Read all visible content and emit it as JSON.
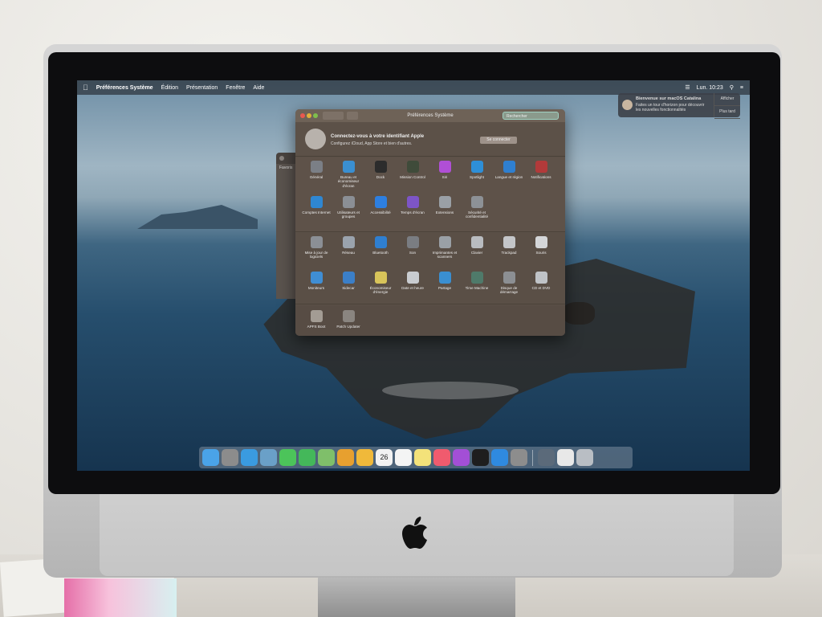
{
  "menubar": {
    "apple_icon": "apple-icon",
    "app_name": "Préférences Système",
    "items": [
      "Édition",
      "Présentation",
      "Fenêtre",
      "Aide"
    ],
    "clock": "Lun. 10:23"
  },
  "notification": {
    "title": "Bienvenue sur macOS Catalina",
    "body": "Faites un tour d'horizon pour découvrir les nouvelles fonctionnalités",
    "show_label": "Afficher",
    "later_label": "Plus tard"
  },
  "finder": {
    "favorites_label": "Favoris"
  },
  "prefs": {
    "title": "Préférences Système",
    "search_placeholder": "Rechercher",
    "account": {
      "title": "Connectez-vous à votre identifiant Apple",
      "subtitle": "Configurez iCloud, App Store et bien d'autres.",
      "button": "Se connecter"
    },
    "section1": [
      {
        "label": "Général",
        "icon": "general-icon",
        "color": "#7b7f86"
      },
      {
        "label": "Bureau et économiseur d'écran",
        "icon": "desktop-icon",
        "color": "#3a8fd1"
      },
      {
        "label": "Dock",
        "icon": "dock-icon",
        "color": "#2c2c2c"
      },
      {
        "label": "Mission Control",
        "icon": "mission-control-icon",
        "color": "#3f4b3a"
      },
      {
        "label": "Siri",
        "icon": "siri-icon",
        "color": "#b04fd6"
      },
      {
        "label": "Spotlight",
        "icon": "spotlight-icon",
        "color": "#2e8fd8"
      },
      {
        "label": "Langue et région",
        "icon": "language-icon",
        "color": "#2f7fd0"
      },
      {
        "label": "Notifications",
        "icon": "notifications-icon",
        "color": "#b23a3a"
      },
      {
        "label": "Comptes Internet",
        "icon": "internet-accounts-icon",
        "color": "#2f87d2"
      },
      {
        "label": "Utilisateurs et groupes",
        "icon": "users-icon",
        "color": "#8b8f95"
      },
      {
        "label": "Accessibilité",
        "icon": "accessibility-icon",
        "color": "#2d7fe0"
      },
      {
        "label": "Temps d'écran",
        "icon": "screen-time-icon",
        "color": "#7d55c7"
      },
      {
        "label": "Extensions",
        "icon": "extensions-icon",
        "color": "#9aa0a6"
      },
      {
        "label": "Sécurité et confidentialité",
        "icon": "security-icon",
        "color": "#8d9196"
      }
    ],
    "section2": [
      {
        "label": "Mise à jour de logiciels",
        "icon": "software-update-icon",
        "color": "#8b8f95"
      },
      {
        "label": "Réseau",
        "icon": "network-icon",
        "color": "#9aa3ad"
      },
      {
        "label": "Bluetooth",
        "icon": "bluetooth-icon",
        "color": "#2f7fd0"
      },
      {
        "label": "Son",
        "icon": "sound-icon",
        "color": "#7a7d82"
      },
      {
        "label": "Imprimantes et scanners",
        "icon": "printers-icon",
        "color": "#9aa0a6"
      },
      {
        "label": "Clavier",
        "icon": "keyboard-icon",
        "color": "#b9bcc0"
      },
      {
        "label": "Trackpad",
        "icon": "trackpad-icon",
        "color": "#c4c6c9"
      },
      {
        "label": "Souris",
        "icon": "mouse-icon",
        "color": "#d4d6d8"
      },
      {
        "label": "Moniteurs",
        "icon": "displays-icon",
        "color": "#3f8ed4"
      },
      {
        "label": "Sidecar",
        "icon": "sidecar-icon",
        "color": "#3b7fc8"
      },
      {
        "label": "Économiseur d'énergie",
        "icon": "energy-saver-icon",
        "color": "#d8c45a"
      },
      {
        "label": "Date et heure",
        "icon": "date-time-icon",
        "color": "#c9ccd0"
      },
      {
        "label": "Partage",
        "icon": "sharing-icon",
        "color": "#3a8fd1"
      },
      {
        "label": "Time Machine",
        "icon": "time-machine-icon",
        "color": "#4f7a6a"
      },
      {
        "label": "Disque de démarrage",
        "icon": "startup-disk-icon",
        "color": "#8c8f93"
      },
      {
        "label": "CD et DVD",
        "icon": "cd-dvd-icon",
        "color": "#c0c3c7"
      }
    ],
    "section3": [
      {
        "label": "APFS Boot",
        "icon": "apfs-boot-icon",
        "color": "#a39c94"
      },
      {
        "label": "Patch Updater",
        "icon": "patch-updater-icon",
        "color": "#8a8580"
      }
    ]
  },
  "dock": [
    {
      "name": "finder-icon",
      "color": "#4aa3e8"
    },
    {
      "name": "launchpad-icon",
      "color": "#8c8c8c"
    },
    {
      "name": "safari-icon",
      "color": "#3a9be0"
    },
    {
      "name": "photo-booth-icon",
      "color": "#6aa0c8"
    },
    {
      "name": "messages-icon",
      "color": "#4cc45a"
    },
    {
      "name": "facetime-icon",
      "color": "#44b85a"
    },
    {
      "name": "maps-icon",
      "color": "#7fbf6a"
    },
    {
      "name": "photos-icon",
      "color": "#e7a02f"
    },
    {
      "name": "notes-icon",
      "color": "#f0b93a"
    },
    {
      "name": "calendar-icon",
      "color": "#f2f2f2"
    },
    {
      "name": "reminders-icon",
      "color": "#f4f4f4"
    },
    {
      "name": "stickies-icon",
      "color": "#f3e27a"
    },
    {
      "name": "music-icon",
      "color": "#f05b6e"
    },
    {
      "name": "podcasts-icon",
      "color": "#a34fd6"
    },
    {
      "name": "apple-tv-icon",
      "color": "#1e1e1e"
    },
    {
      "name": "app-store-icon",
      "color": "#2f8ae0"
    },
    {
      "name": "system-preferences-icon",
      "color": "#8d8d8d"
    },
    {
      "name": "sep",
      "color": ""
    },
    {
      "name": "activity-icon",
      "color": "#5b6a7a"
    },
    {
      "name": "document-icon",
      "color": "#e8e8e8"
    },
    {
      "name": "trash-icon",
      "color": "#b9bec4"
    }
  ],
  "dock_calendar_day": "26"
}
